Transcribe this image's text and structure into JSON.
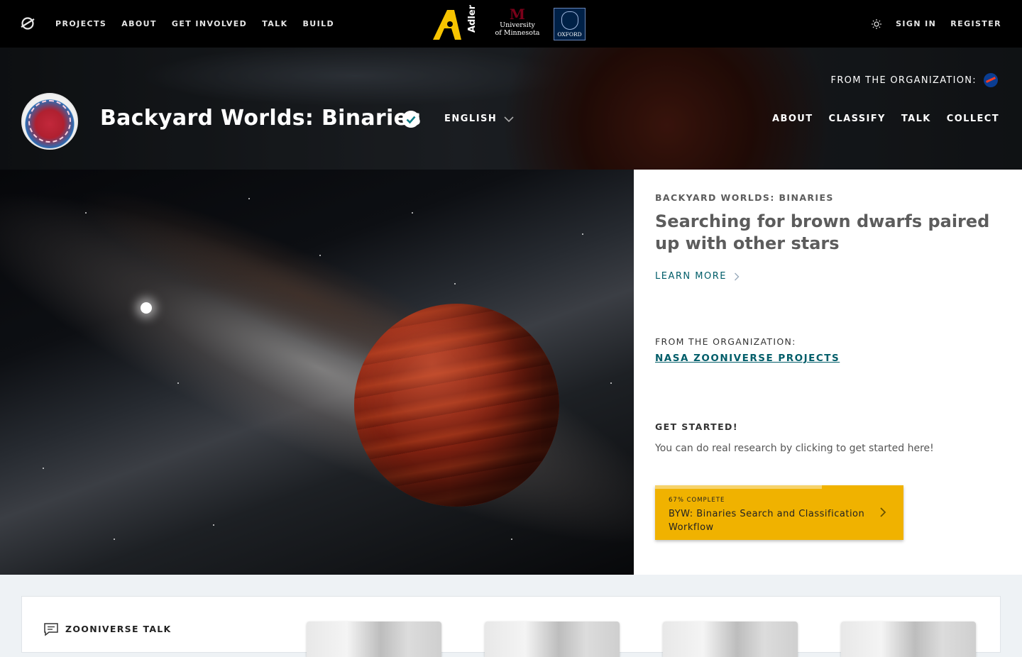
{
  "topnav": {
    "items": [
      "PROJECTS",
      "ABOUT",
      "GET INVOLVED",
      "TALK",
      "BUILD"
    ],
    "sign_in": "SIGN IN",
    "register": "REGISTER"
  },
  "partners": {
    "adler": "Adler",
    "umn_line1": "University",
    "umn_line2": "of Minnesota",
    "oxford": "OXFORD"
  },
  "project": {
    "title": "Backyard Worlds: Binaries",
    "language": "ENGLISH",
    "from_org": "FROM THE ORGANIZATION:",
    "nav": [
      "ABOUT",
      "CLASSIFY",
      "TALK",
      "COLLECT"
    ]
  },
  "intro": {
    "kicker": "BACKYARD WORLDS: BINARIES",
    "headline": "Searching for brown dwarfs paired up with other stars",
    "learn_more": "LEARN MORE",
    "org_label": "FROM THE ORGANIZATION:",
    "org_link": "NASA ZOONIVERSE PROJECTS",
    "get_started": "GET STARTED!",
    "get_started_desc": "You can do real research by clicking to get started here!",
    "workflow": {
      "percent_label": "67% COMPLETE",
      "progress": 0.67,
      "name": "BYW: Binaries Search and Classification Workflow"
    }
  },
  "talk": {
    "label": "ZOONIVERSE TALK"
  },
  "colors": {
    "accent_teal": "#005d69",
    "workflow_yellow": "#f0b200",
    "topbar": "#000000"
  },
  "icons": [
    "zooniverse-logo-icon",
    "sun-icon",
    "verified-check-icon",
    "chevron-down-icon",
    "chevron-right-icon",
    "nasa-logo-icon",
    "talk-bubble-icon"
  ]
}
